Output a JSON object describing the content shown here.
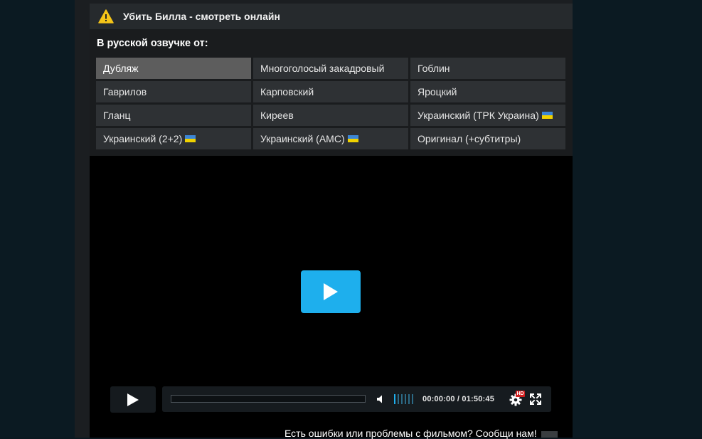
{
  "header": {
    "title": "Убить Билла - смотреть онлайн",
    "icon": "warning-icon"
  },
  "dubbing": {
    "heading": "В русской озвучке от:",
    "active_index": 0,
    "options": [
      {
        "label": "Дубляж",
        "flag": false
      },
      {
        "label": "Многоголосый закадровый",
        "flag": false
      },
      {
        "label": "Гоблин",
        "flag": false
      },
      {
        "label": "Гаврилов",
        "flag": false
      },
      {
        "label": "Карповский",
        "flag": false
      },
      {
        "label": "Яроцкий",
        "flag": false
      },
      {
        "label": "Гланц",
        "flag": false
      },
      {
        "label": "Киреев",
        "flag": false
      },
      {
        "label": "Украинский (ТРК Украина)",
        "flag": true
      },
      {
        "label": "Украинский (2+2)",
        "flag": true
      },
      {
        "label": "Украинский (АМС)",
        "flag": true
      },
      {
        "label": "Оригинал (+субтитры)",
        "flag": false
      }
    ]
  },
  "player": {
    "time_current": "00:00:00",
    "time_separator": " / ",
    "time_total": "01:50:45",
    "progress": 0,
    "volume_level": 0.2,
    "quality_badge": "HD",
    "accent_color": "#1eafed"
  },
  "footer": {
    "report_text": "Есть ошибки или проблемы с фильмом? Сообщи нам!"
  }
}
